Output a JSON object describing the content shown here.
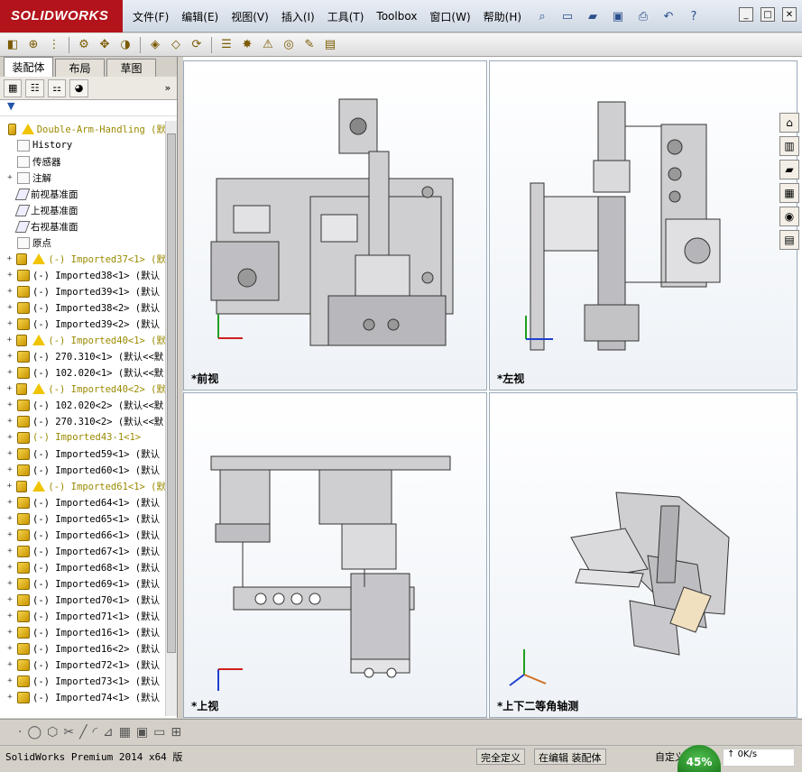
{
  "app": {
    "brand": "SOLIDWORKS"
  },
  "menu": [
    "文件(F)",
    "编辑(E)",
    "视图(V)",
    "插入(I)",
    "工具(T)",
    "Toolbox",
    "窗口(W)",
    "帮助(H)"
  ],
  "panel_tabs": [
    "装配体",
    "布局",
    "草图"
  ],
  "tree": {
    "root": "Double-Arm-Handling (默",
    "items": [
      {
        "label": "History",
        "icon": "history",
        "exp": ""
      },
      {
        "label": "传感器",
        "icon": "sensor",
        "exp": ""
      },
      {
        "label": "注解",
        "icon": "annotation",
        "exp": "+"
      },
      {
        "label": "前视基准面",
        "icon": "plane",
        "exp": ""
      },
      {
        "label": "上视基准面",
        "icon": "plane",
        "exp": ""
      },
      {
        "label": "右视基准面",
        "icon": "plane",
        "exp": ""
      },
      {
        "label": "原点",
        "icon": "origin",
        "exp": ""
      },
      {
        "label": "(-) Imported37<1> (默",
        "icon": "warn",
        "exp": "+",
        "yellow": true
      },
      {
        "label": "(-) Imported38<1> (默认",
        "icon": "part",
        "exp": "+"
      },
      {
        "label": "(-) Imported39<1> (默认",
        "icon": "part",
        "exp": "+"
      },
      {
        "label": "(-) Imported38<2> (默认",
        "icon": "part",
        "exp": "+"
      },
      {
        "label": "(-) Imported39<2> (默认",
        "icon": "part",
        "exp": "+"
      },
      {
        "label": "(-) Imported40<1> (默",
        "icon": "warn",
        "exp": "+",
        "yellow": true
      },
      {
        "label": "(-) 270.310<1> (默认<<默",
        "icon": "part",
        "exp": "+"
      },
      {
        "label": "(-) 102.020<1> (默认<<默",
        "icon": "part",
        "exp": "+"
      },
      {
        "label": "(-) Imported40<2> (默",
        "icon": "warn",
        "exp": "+",
        "yellow": true
      },
      {
        "label": "(-) 102.020<2> (默认<<默",
        "icon": "part",
        "exp": "+"
      },
      {
        "label": "(-) 270.310<2> (默认<<默",
        "icon": "part",
        "exp": "+"
      },
      {
        "label": "(-) Imported43-1<1>",
        "icon": "part",
        "exp": "+",
        "yellow": true
      },
      {
        "label": "(-) Imported59<1> (默认",
        "icon": "part",
        "exp": "+"
      },
      {
        "label": "(-) Imported60<1> (默认",
        "icon": "part",
        "exp": "+"
      },
      {
        "label": "(-) Imported61<1> (默",
        "icon": "warn",
        "exp": "+",
        "yellow": true
      },
      {
        "label": "(-) Imported64<1> (默认",
        "icon": "part",
        "exp": "+"
      },
      {
        "label": "(-) Imported65<1> (默认",
        "icon": "part",
        "exp": "+"
      },
      {
        "label": "(-) Imported66<1> (默认",
        "icon": "part",
        "exp": "+"
      },
      {
        "label": "(-) Imported67<1> (默认",
        "icon": "part",
        "exp": "+"
      },
      {
        "label": "(-) Imported68<1> (默认",
        "icon": "part",
        "exp": "+"
      },
      {
        "label": "(-) Imported69<1> (默认",
        "icon": "part",
        "exp": "+"
      },
      {
        "label": "(-) Imported70<1> (默认",
        "icon": "part",
        "exp": "+"
      },
      {
        "label": "(-) Imported71<1> (默认",
        "icon": "part",
        "exp": "+"
      },
      {
        "label": "(-) Imported16<1> (默认",
        "icon": "part",
        "exp": "+"
      },
      {
        "label": "(-) Imported16<2> (默认",
        "icon": "part",
        "exp": "+"
      },
      {
        "label": "(-) Imported72<1> (默认",
        "icon": "part",
        "exp": "+"
      },
      {
        "label": "(-) Imported73<1> (默认",
        "icon": "part",
        "exp": "+"
      },
      {
        "label": "(-) Imported74<1> (默认",
        "icon": "part",
        "exp": "+"
      }
    ]
  },
  "views": {
    "front": "*前视",
    "left": "*左视",
    "top": "*上视",
    "iso": "*上下二等角轴测"
  },
  "status": {
    "version": "SolidWorks Premium 2014 x64 版",
    "fully_defined": "完全定义",
    "editing": "在编辑 装配体",
    "custom": "自定义",
    "cpu": "45%",
    "speed": "0K/s"
  },
  "colors": {
    "accent": "#b3141c",
    "axis_x": "#d02020",
    "axis_y": "#20a020",
    "axis_z": "#2040d0"
  }
}
